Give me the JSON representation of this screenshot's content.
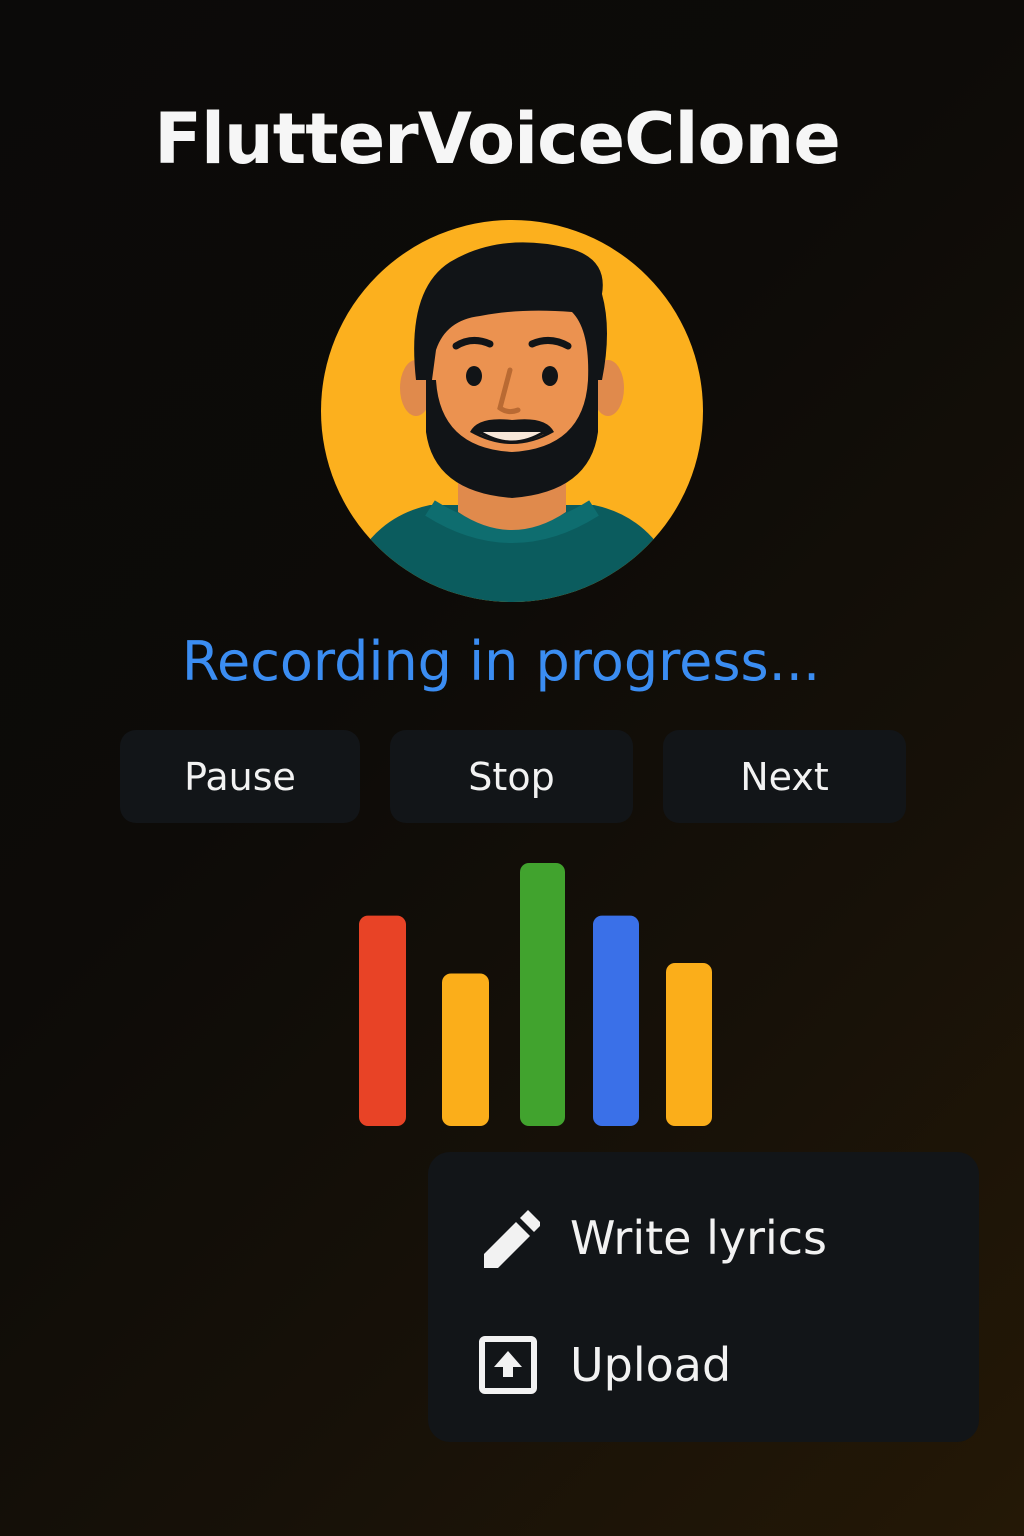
{
  "app": {
    "title": "FlutterVoiceClone"
  },
  "avatar": {
    "icon": "user-avatar-icon",
    "background_color": "#fcb01e",
    "shirt_color": "#0b5c5e"
  },
  "status": {
    "text": "Recording in progress...",
    "color": "#3b8df2"
  },
  "controls": {
    "pause_label": "Pause",
    "stop_label": "Stop",
    "next_label": "Next"
  },
  "visualizer": {
    "bars": [
      {
        "level": 0.8,
        "color": "#e84326"
      },
      {
        "level": 0.58,
        "color": "#fbae1a"
      },
      {
        "level": 1.0,
        "color": "#41a32e"
      },
      {
        "level": 0.8,
        "color": "#3a70e8"
      },
      {
        "level": 0.62,
        "color": "#fbae1a"
      }
    ]
  },
  "menu": {
    "items": [
      {
        "label": "Write lyrics",
        "icon": "pencil-icon"
      },
      {
        "label": "Upload",
        "icon": "upload-icon"
      }
    ]
  }
}
